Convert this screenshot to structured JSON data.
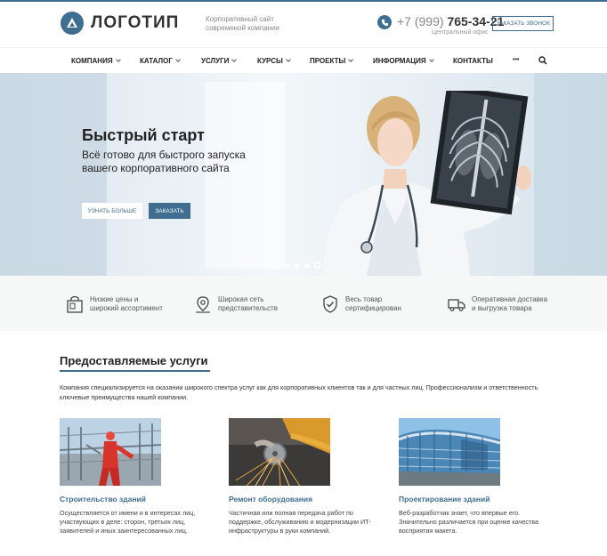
{
  "header": {
    "logo_text": "ЛОГОТИП",
    "slogan": "Корпоративный сайт современой компании",
    "phone_code": "+7 (999)",
    "phone_number": "765-34-21",
    "phone_sub": "Центральный офис",
    "callback_label": "ЗАКАЗАТЬ ЗВОНОК"
  },
  "nav": {
    "items": [
      {
        "label": "КОМПАНИЯ"
      },
      {
        "label": "КАТАЛОГ"
      },
      {
        "label": "УСЛУГИ"
      },
      {
        "label": "КУРСЫ"
      },
      {
        "label": "ПРОЕКТЫ"
      },
      {
        "label": "ИНФОРМАЦИЯ"
      },
      {
        "label": "КОНТАКТЫ"
      }
    ],
    "more_label": "•••"
  },
  "hero": {
    "title": "Быстрый старт",
    "text": "Всё готово для быстрого запуска вашего корпоративного сайта",
    "btn_more": "УЗНАТЬ БОЛЬШЕ",
    "btn_order": "ЗАКАЗАТЬ",
    "slide_count": 4,
    "active_slide": 4
  },
  "features": [
    {
      "line1": "Низкие цены и",
      "line2": "широкий ассортимент",
      "icon": "shopping-bag-icon"
    },
    {
      "line1": "Широкая сеть",
      "line2": "представительств",
      "icon": "map-pin-icon"
    },
    {
      "line1": "Весь товар",
      "line2": "сертифицирован",
      "icon": "shield-check-icon"
    },
    {
      "line1": "Оперативная доставка",
      "line2": "и выгрузка товара",
      "icon": "truck-icon"
    }
  ],
  "services": {
    "title": "Предоставляемые услуги",
    "description": "Компания специализируется на оказании широкого спектра услуг как для корпоративных клиентов так и для частных лиц. Профессионализм и ответственность ключевые преимущества нашей компании.",
    "cards": [
      {
        "title": "Строительство зданий",
        "text": "Осуществляется от имени и в интересах лиц, участвующих в деле: сторон, третьих лиц, заявителей и иных заинтересованных лиц."
      },
      {
        "title": "Ремонт оборудования",
        "text": "Частичная или полная передача работ по поддержке, обслуживанию и модернизации ИТ-инфраструктуры в руки компаний."
      },
      {
        "title": "Проектирование зданий",
        "text": "Веб-разработчик знает, что впервые его. Значительно различается при оценке качества восприятия макета."
      }
    ]
  },
  "colors": {
    "accent": "#3f6e91"
  }
}
